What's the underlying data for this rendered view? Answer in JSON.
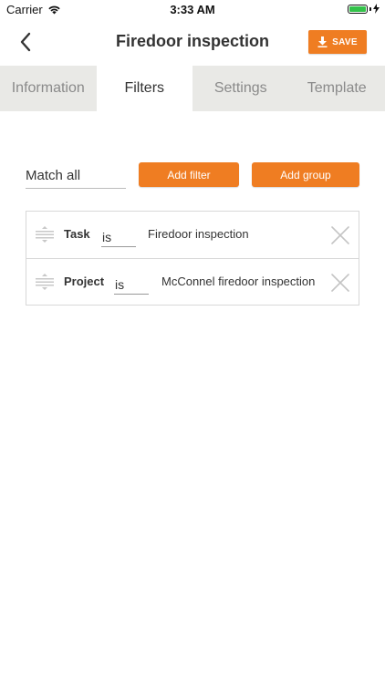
{
  "status_bar": {
    "carrier": "Carrier",
    "time": "3:33 AM",
    "battery_color": "#33c24a"
  },
  "header": {
    "title": "Firedoor inspection",
    "save_label": "SAVE",
    "accent_color": "#ef7d22",
    "back_icon": "chevron-left-icon",
    "save_icon": "download-icon"
  },
  "tabs": [
    {
      "label": "Information",
      "active": false
    },
    {
      "label": "Filters",
      "active": true
    },
    {
      "label": "Settings",
      "active": false
    },
    {
      "label": "Template",
      "active": false
    }
  ],
  "filters": {
    "match_mode": "Match all",
    "add_filter_label": "Add filter",
    "add_group_label": "Add group",
    "rows": [
      {
        "field": "Task",
        "operator": "is",
        "value": "Firedoor inspection"
      },
      {
        "field": "Project",
        "operator": "is",
        "value": "McConnel firedoor inspection"
      }
    ]
  }
}
